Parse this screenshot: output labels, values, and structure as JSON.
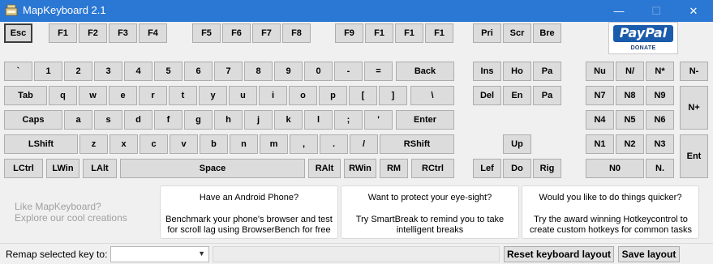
{
  "window": {
    "title": "MapKeyboard 2.1",
    "controls": {
      "minimize": "—",
      "maximize": "☐",
      "close": "✕"
    }
  },
  "keys": {
    "function_row": [
      "Esc",
      "F1",
      "F2",
      "F3",
      "F4",
      "F5",
      "F6",
      "F7",
      "F8",
      "F9",
      "F1",
      "F1",
      "F1",
      "Pri",
      "Scr",
      "Bre"
    ],
    "number_row": [
      "`",
      "1",
      "2",
      "3",
      "4",
      "5",
      "6",
      "7",
      "8",
      "9",
      "0",
      "-",
      "=",
      "Back"
    ],
    "tab_row": [
      "Tab",
      "q",
      "w",
      "e",
      "r",
      "t",
      "y",
      "u",
      "i",
      "o",
      "p",
      "[",
      "]",
      "\\"
    ],
    "caps_row": [
      "Caps",
      "a",
      "s",
      "d",
      "f",
      "g",
      "h",
      "j",
      "k",
      "l",
      ";",
      "'",
      "Enter"
    ],
    "shift_row": [
      "LShift",
      "z",
      "x",
      "c",
      "v",
      "b",
      "n",
      "m",
      ",",
      ".",
      "/",
      "RShift"
    ],
    "bottom_row": [
      "LCtrl",
      "LWin",
      "LAlt",
      "Space",
      "RAlt",
      "RWin",
      "RM",
      "RCtrl"
    ],
    "nav_block": [
      "Ins",
      "Ho",
      "Pa",
      "Del",
      "En",
      "Pa"
    ],
    "arrows": [
      "Up",
      "Lef",
      "Do",
      "Rig"
    ],
    "numpad": [
      "Nu",
      "N/",
      "N*",
      "N-",
      "N7",
      "N8",
      "N9",
      "N+",
      "N4",
      "N5",
      "N6",
      "N1",
      "N2",
      "N3",
      "Ent",
      "N0",
      "N."
    ]
  },
  "paypal": {
    "logo": "PayPal",
    "caption": "DONATE"
  },
  "promo": {
    "like_line1": "Like MapKeyboard?",
    "like_line2": "Explore our cool creations",
    "cards": [
      {
        "title": "Have an Android Phone?",
        "body": "Benchmark your phone's browser and test for scroll lag using BrowserBench for free"
      },
      {
        "title": "Want to protect your eye-sight?",
        "body": "Try SmartBreak to remind you to take intelligent breaks"
      },
      {
        "title": "Would you like to do things quicker?",
        "body": "Try the award winning Hotkeycontrol to create custom hotkeys for common tasks"
      }
    ]
  },
  "statusbar": {
    "remap_label": "Remap selected key to:",
    "remap_value": "",
    "reset_button": "Reset keyboard layout",
    "save_button": "Save layout"
  }
}
